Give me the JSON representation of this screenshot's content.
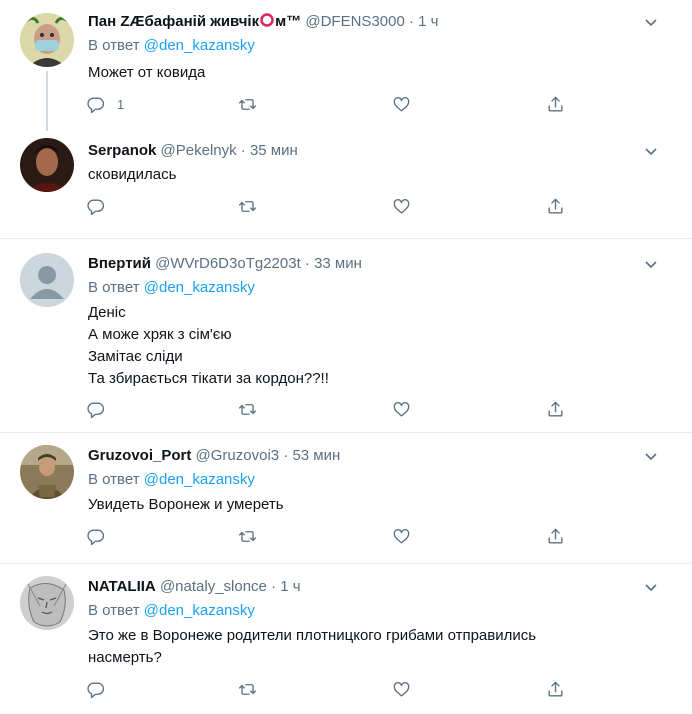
{
  "tweets": [
    {
      "name": "Пан ZÆбафаній живчік",
      "name_tail": "м™",
      "handle": "@DFENS3000",
      "time": "· 1 ч",
      "reply_prefix": "В ответ",
      "reply_to": "@den_kazansky",
      "lines": [
        "Может от ковида"
      ],
      "reply_count": "1",
      "avatar": "masked-man-avatar"
    },
    {
      "name": "Serpanok",
      "handle": "@Pekelnyk",
      "time": "· 35 мин",
      "lines": [
        "сковидилась"
      ],
      "reply_count": "",
      "avatar": "man-photo-avatar"
    },
    {
      "name": "Впертий",
      "handle": "@WVrD6D3oTg2203t",
      "time": "· 33 мин",
      "reply_prefix": "В ответ",
      "reply_to": "@den_kazansky",
      "lines": [
        "Деніс",
        "А може хряк з сім'єю",
        "Замітає сліди",
        "Та збирається тікати за кордон??!!"
      ],
      "reply_count": "",
      "avatar": "default-avatar"
    },
    {
      "name": "Gruzovoi_Port",
      "handle": "@Gruzovoi3",
      "time": "· 53 мин",
      "reply_prefix": "В ответ",
      "reply_to": "@den_kazansky",
      "lines": [
        "Увидеть Воронеж и умереть"
      ],
      "reply_count": "",
      "avatar": "soldier-photo-avatar"
    },
    {
      "name": "NATALIIA",
      "handle": "@nataly_slonce",
      "time": "· 1 ч",
      "reply_prefix": "В ответ",
      "reply_to": "@den_kazansky",
      "lines": [
        "Это же  в Воронеже родители плотницкого грибами отправились",
        "насмерть?"
      ],
      "reply_count": "",
      "avatar": "sketch-face-avatar"
    }
  ],
  "colors": {
    "accent": "#1da1f2",
    "muted": "#5b7083",
    "text": "#0f1419",
    "ring": "#e0245e"
  },
  "icons": [
    "reply-icon",
    "retweet-icon",
    "like-icon",
    "share-icon",
    "chevron-down-icon"
  ]
}
